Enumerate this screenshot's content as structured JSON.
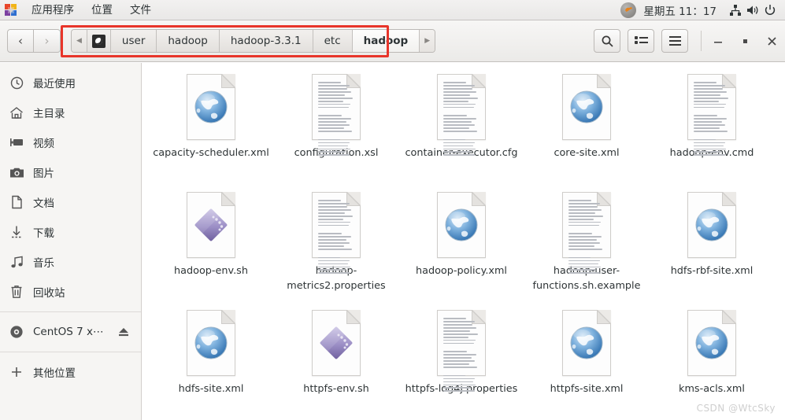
{
  "panel": {
    "logo_icon": "gnome-pinwheel-icon",
    "menus": [
      "应用程序",
      "位置",
      "文件"
    ],
    "status_icon": "system-indicator-icon",
    "clock": "星期五 11：17",
    "tray": [
      "network-icon",
      "volume-icon",
      "power-icon"
    ]
  },
  "headerbar": {
    "back_label": "‹",
    "forward_label": "›",
    "breadcrumb": {
      "root_icon": "filesystem-icon",
      "prev_arrow": "◀",
      "items": [
        {
          "label": "user",
          "active": false
        },
        {
          "label": "hadoop",
          "active": false
        },
        {
          "label": "hadoop-3.3.1",
          "active": false
        },
        {
          "label": "etc",
          "active": false
        },
        {
          "label": "hadoop",
          "active": true
        }
      ],
      "next_arrow": "▶",
      "highlight_color": "#e8352a"
    },
    "tools": [
      {
        "name": "search-button",
        "icon": "search-icon"
      },
      {
        "name": "view-list-button",
        "icon": "list-view-icon"
      },
      {
        "name": "menu-button",
        "icon": "hamburger-menu-icon"
      }
    ],
    "window_controls": [
      {
        "name": "minimize-button",
        "glyph": "–"
      },
      {
        "name": "maximize-button",
        "glyph": "▫"
      },
      {
        "name": "close-button",
        "glyph": "✕"
      }
    ]
  },
  "sidebar": {
    "items": [
      {
        "label": "最近使用",
        "icon": "clock-icon",
        "name": "sidebar-item-recent"
      },
      {
        "label": "主目录",
        "icon": "home-icon",
        "name": "sidebar-item-home"
      },
      {
        "label": "视频",
        "icon": "video-icon",
        "name": "sidebar-item-videos"
      },
      {
        "label": "图片",
        "icon": "camera-icon",
        "name": "sidebar-item-pictures"
      },
      {
        "label": "文档",
        "icon": "document-icon",
        "name": "sidebar-item-documents"
      },
      {
        "label": "下载",
        "icon": "download-icon",
        "name": "sidebar-item-downloads"
      },
      {
        "label": "音乐",
        "icon": "music-icon",
        "name": "sidebar-item-music"
      },
      {
        "label": "回收站",
        "icon": "trash-icon",
        "name": "sidebar-item-trash"
      }
    ],
    "devices": [
      {
        "label": "CentOS 7 x⋯",
        "icon": "disc-icon",
        "eject_icon": "eject-icon",
        "name": "sidebar-item-centos-disc"
      }
    ],
    "other": {
      "label": "其他位置",
      "icon": "plus-icon",
      "name": "sidebar-item-other-locations"
    }
  },
  "files": [
    {
      "name": "capacity-scheduler.xml",
      "icon": "xml-globe-icon"
    },
    {
      "name": "configuration.xsl",
      "icon": "text-document-icon"
    },
    {
      "name": "container-executor.cfg",
      "icon": "text-document-icon"
    },
    {
      "name": "core-site.xml",
      "icon": "xml-globe-icon"
    },
    {
      "name": "hadoop-env.cmd",
      "icon": "text-document-icon"
    },
    {
      "name": "hadoop-env.sh",
      "icon": "shell-script-icon"
    },
    {
      "name": "hadoop-metrics2.properties",
      "icon": "text-document-icon"
    },
    {
      "name": "hadoop-policy.xml",
      "icon": "xml-globe-icon"
    },
    {
      "name": "hadoop-user-functions.sh.example",
      "icon": "text-document-icon"
    },
    {
      "name": "hdfs-rbf-site.xml",
      "icon": "xml-globe-icon"
    },
    {
      "name": "hdfs-site.xml",
      "icon": "xml-globe-icon"
    },
    {
      "name": "httpfs-env.sh",
      "icon": "shell-script-icon"
    },
    {
      "name": "httpfs-log4j.properties",
      "icon": "text-document-icon"
    },
    {
      "name": "httpfs-site.xml",
      "icon": "xml-globe-icon"
    },
    {
      "name": "kms-acls.xml",
      "icon": "xml-globe-icon"
    }
  ],
  "watermark": "CSDN @WtcSky"
}
